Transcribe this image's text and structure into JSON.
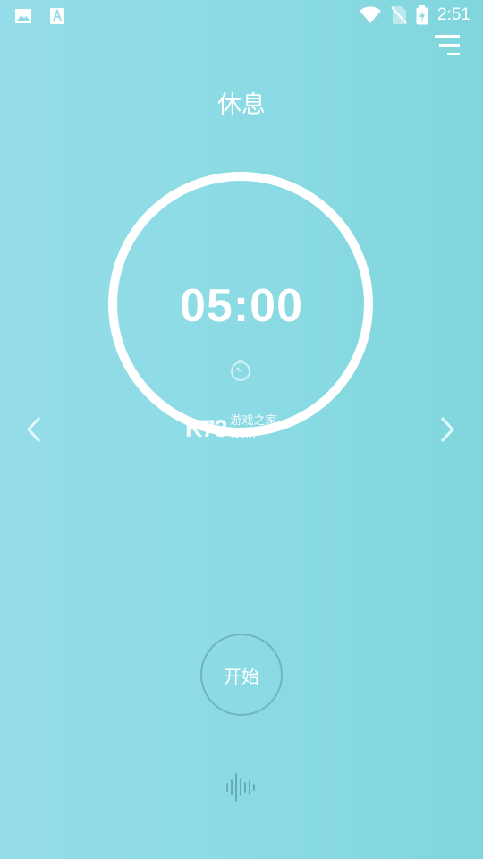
{
  "status_bar": {
    "time": "2:51",
    "icons": [
      "image-icon",
      "font-a-icon",
      "wifi-icon",
      "no-sim-icon",
      "battery-charging-icon"
    ]
  },
  "header": {
    "menu_icon": "menu-icon"
  },
  "mode": {
    "title": "休息"
  },
  "timer": {
    "display": "05:00",
    "icon": "stopwatch-icon"
  },
  "navigation": {
    "prev_icon": "chevron-left-icon",
    "next_icon": "chevron-right-icon"
  },
  "watermark": {
    "logo": "K73",
    "text": "游戏之家",
    "domain": ".com"
  },
  "controls": {
    "start_label": "开始",
    "sound_icon": "sound-wave-icon"
  },
  "colors": {
    "background_start": "#95dde9",
    "background_end": "#80d6dc",
    "ring": "#ffffff",
    "button_border": "#6fb5bd"
  }
}
